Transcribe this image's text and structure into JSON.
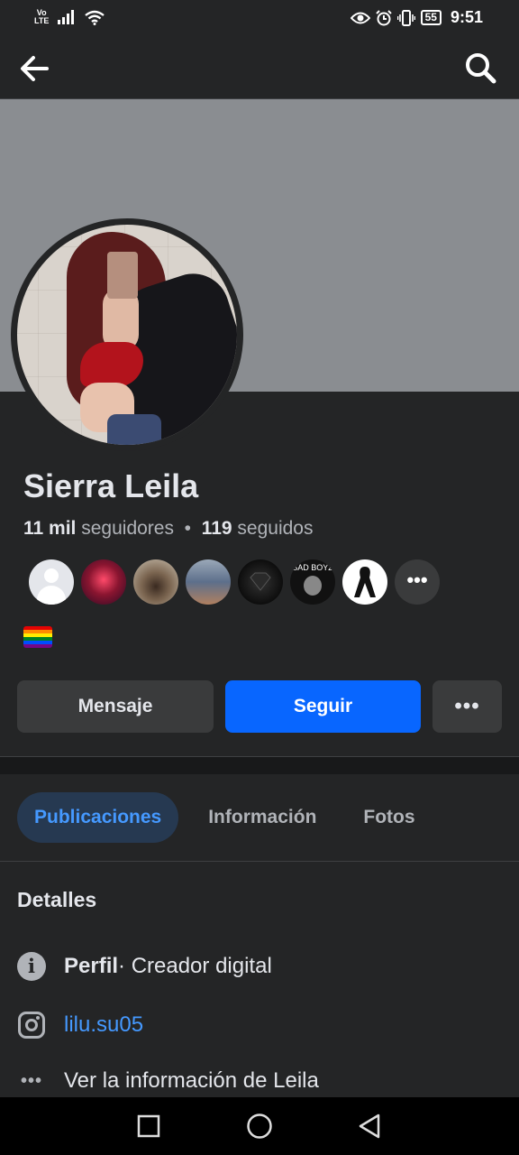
{
  "status_bar": {
    "volte_top": "Vo",
    "volte_bottom": "LTE",
    "battery": "55",
    "time": "9:51"
  },
  "app_bar": {
    "back_icon": "arrow-left-icon",
    "search_icon": "search-icon"
  },
  "profile": {
    "name": "Sierra Leila",
    "followers_count": "11 mil",
    "followers_label": "seguidores",
    "separator": "•",
    "following_count": "119",
    "following_label": "seguidos",
    "more_followers_glyph": "•••",
    "flag_colors": [
      "#e40303",
      "#ff8c00",
      "#ffed00",
      "#008026",
      "#004dff",
      "#750787"
    ],
    "sticker_text": "SAD BOYZ"
  },
  "actions": {
    "message_label": "Mensaje",
    "follow_label": "Seguir",
    "more_label": "•••"
  },
  "tabs": [
    {
      "label": "Publicaciones",
      "active": true
    },
    {
      "label": "Información",
      "active": false
    },
    {
      "label": "Fotos",
      "active": false
    }
  ],
  "details": {
    "title": "Detalles",
    "profile_label": "Perfil",
    "profile_value": " · Creador digital",
    "instagram_handle": "lilu.su05",
    "see_more": "Ver la información de Leila"
  },
  "colors": {
    "background": "#242526",
    "accent": "#0866ff",
    "link": "#4599ff"
  }
}
